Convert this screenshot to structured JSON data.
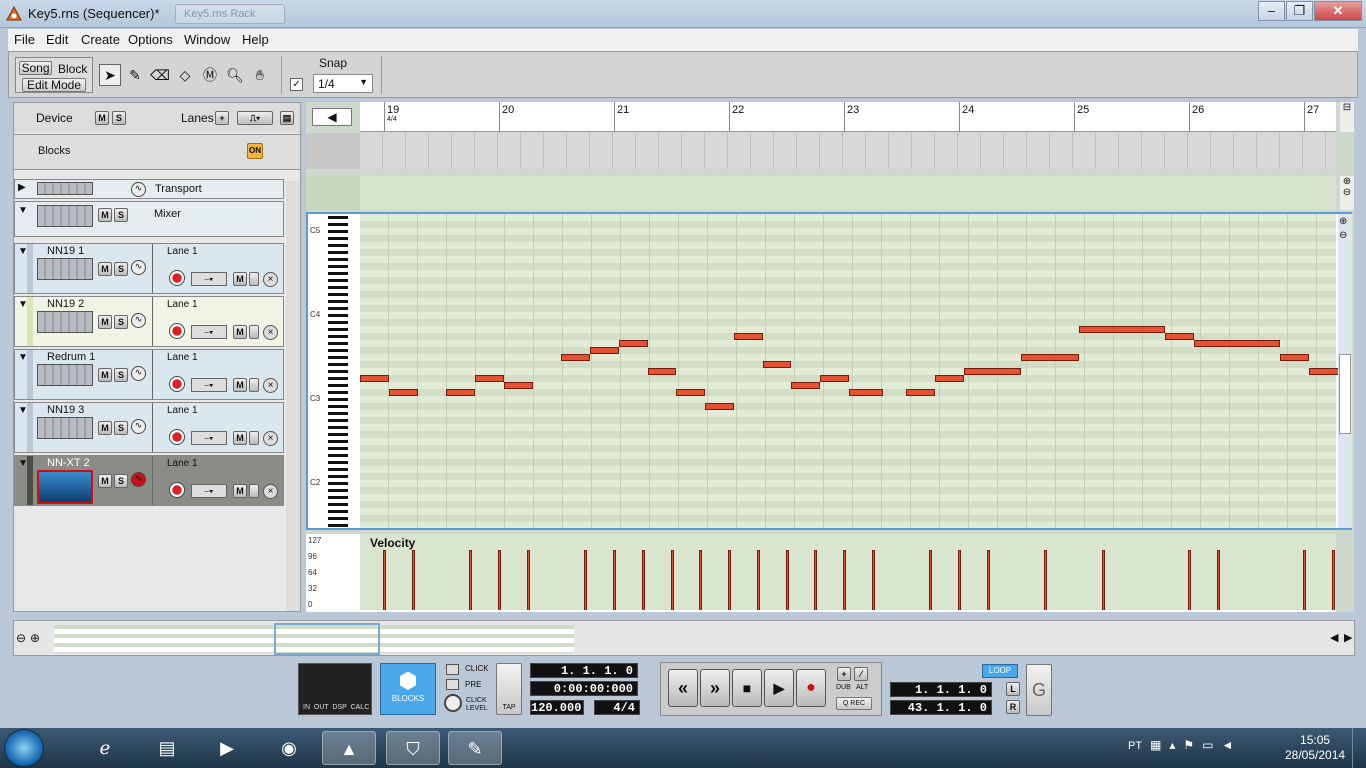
{
  "window": {
    "title": "Key5.rns (Sequencer)*",
    "ghost": "Key5.rns Rack"
  },
  "menu": [
    "File",
    "Edit",
    "Create",
    "Options",
    "Window",
    "Help"
  ],
  "toolbar": {
    "song": "Song",
    "block": "Block",
    "edit_mode": "Edit Mode",
    "snap_label": "Snap",
    "snap_value": "1/4"
  },
  "left_panel": {
    "device": "Device",
    "lanes": "Lanes",
    "blocks": "Blocks",
    "on": "ON",
    "transport": "Transport",
    "mixer": "Mixer",
    "mute": "M",
    "solo": "S",
    "tracks": [
      {
        "name": "NN19 1",
        "lane": "Lane 1"
      },
      {
        "name": "NN19 2",
        "lane": "Lane 1"
      },
      {
        "name": "Redrum 1",
        "lane": "Lane 1"
      },
      {
        "name": "NN19 3",
        "lane": "Lane 1"
      },
      {
        "name": "NN-XT 2",
        "lane": "Lane 1"
      }
    ]
  },
  "ruler": {
    "bars": [
      "19",
      "20",
      "21",
      "22",
      "23",
      "24",
      "25",
      "26",
      "27"
    ],
    "sig": "4/4"
  },
  "octaves": [
    "C5",
    "C4",
    "C3",
    "C2"
  ],
  "notes": [
    {
      "beat": 0,
      "pitch": "D#3"
    },
    {
      "beat": 1,
      "pitch": "C#3"
    },
    {
      "beat": 3,
      "pitch": "C#3"
    },
    {
      "beat": 4,
      "pitch": "D#3"
    },
    {
      "beat": 5,
      "pitch": "D3"
    },
    {
      "beat": 7,
      "pitch": "F#3"
    },
    {
      "beat": 8,
      "pitch": "G3"
    },
    {
      "beat": 9,
      "pitch": "G#3"
    },
    {
      "beat": 10,
      "pitch": "E3"
    },
    {
      "beat": 11,
      "pitch": "C#3"
    },
    {
      "beat": 12,
      "pitch": "B2"
    },
    {
      "beat": 13,
      "pitch": "A3"
    },
    {
      "beat": 14,
      "pitch": "F3"
    },
    {
      "beat": 15,
      "pitch": "D3"
    },
    {
      "beat": 16,
      "pitch": "D#3"
    },
    {
      "beat": 17,
      "pitch": "C#3"
    },
    {
      "beat": 19,
      "pitch": "C#3"
    },
    {
      "beat": 20,
      "pitch": "D#3"
    },
    {
      "beat": 21,
      "pitch": "E3"
    },
    {
      "beat": 23,
      "pitch": "F#3"
    },
    {
      "beat": 25,
      "pitch": "A#3"
    },
    {
      "beat": 28,
      "pitch": "A3"
    },
    {
      "beat": 29,
      "pitch": "G#3"
    },
    {
      "beat": 32,
      "pitch": "F#3"
    },
    {
      "beat": 33,
      "pitch": "E3"
    }
  ],
  "velocity": {
    "title": "Velocity",
    "labels": [
      "127",
      "96",
      "64",
      "32",
      "0"
    ]
  },
  "transport": {
    "pos": "1. 1. 1.   0",
    "time": "0:00:00:000",
    "tempo": "120.000",
    "sig": "4/4",
    "left": "1. 1. 1.   0",
    "right": "43. 1. 1.   0",
    "loop": "LOOP",
    "click": "CLICK",
    "pre": "PRE",
    "click_level": "CLICK LEVEL",
    "tap": "TAP",
    "dub": "DUB",
    "alt": "ALT",
    "qrec": "Q REC",
    "blocks": "BLOCKS",
    "io": "IN  OUT  DSP  CALC",
    "L": "L",
    "R": "R"
  },
  "taskbar": {
    "lang": "PT",
    "time": "15:05",
    "date": "28/05/2014"
  }
}
